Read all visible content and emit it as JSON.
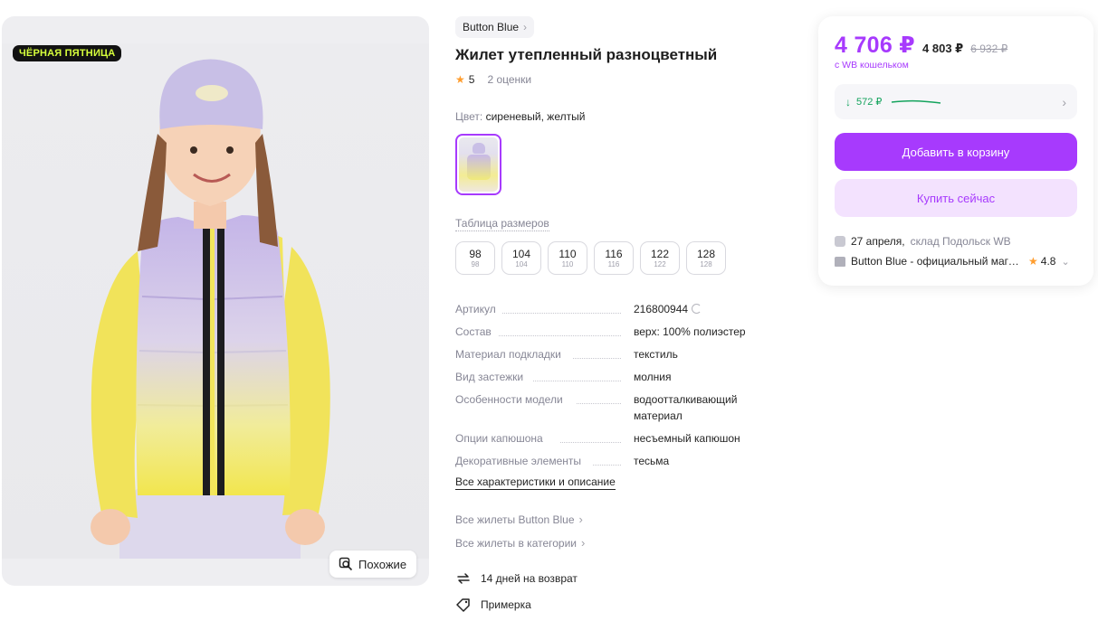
{
  "promo_badge": "ЧЁРНАЯ ПЯТНИЦА",
  "similar_label": "Похожие",
  "brand": "Button Blue",
  "title": "Жилет утепленный разноцветный",
  "rating": "5",
  "reviews": "2 оценки",
  "color": {
    "label": "Цвет:",
    "value": "сиреневый, желтый"
  },
  "size_table_label": "Таблица размеров",
  "sizes": [
    {
      "size": "98",
      "ru": "98"
    },
    {
      "size": "104",
      "ru": "104"
    },
    {
      "size": "110",
      "ru": "110"
    },
    {
      "size": "116",
      "ru": "116"
    },
    {
      "size": "122",
      "ru": "122"
    },
    {
      "size": "128",
      "ru": "128"
    }
  ],
  "specs": [
    {
      "key": "Артикул",
      "value": "216800944"
    },
    {
      "key": "Состав",
      "value": "верх: 100% полиэстер"
    },
    {
      "key": "Материал подкладки",
      "value": "текстиль"
    },
    {
      "key": "Вид застежки",
      "value": "молния"
    },
    {
      "key": "Особенности модели",
      "value": "водоотталкивающий материал"
    },
    {
      "key": "Опции капюшона",
      "value": "несъемный капюшон"
    },
    {
      "key": "Декоративные элементы",
      "value": "тесьма"
    }
  ],
  "all_chars_label": "Все характеристики и описание",
  "links": {
    "brand_vests": "Все жилеты Button Blue",
    "category_vests": "Все жилеты в категории"
  },
  "features": {
    "returns": "14 дней на возврат",
    "fitting": "Примерка"
  },
  "price": {
    "current": "4 706 ₽",
    "regular": "4 803 ₽",
    "old": "6 932 ₽",
    "wallet_note": "с WB кошельком",
    "history_drop": "572 ₽"
  },
  "buttons": {
    "add_to_cart": "Добавить в корзину",
    "buy_now": "Купить сейчас"
  },
  "delivery": {
    "date": "27 апреля,",
    "warehouse": "склад Подольск WB"
  },
  "seller": {
    "name": "Button Blue - официальный магазин",
    "rating": "4.8"
  },
  "colors": {
    "accent": "#a73afd",
    "accent_light": "#f3e2fe",
    "green": "#14a35d",
    "star": "#ff9d2e"
  }
}
